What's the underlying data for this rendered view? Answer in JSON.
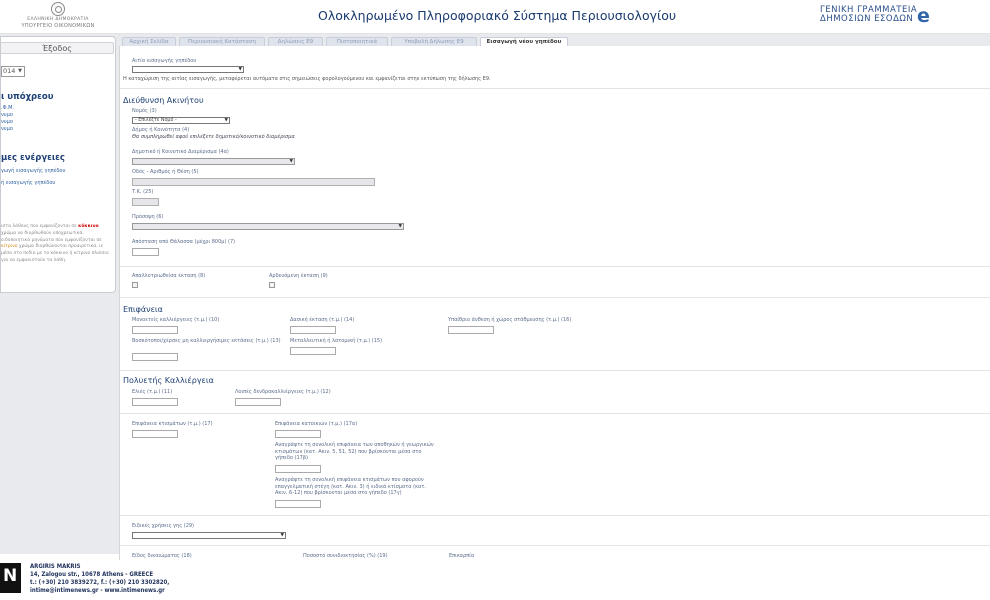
{
  "header": {
    "ministry_line1": "ΕΛΛΗΝΙΚΗ ΔΗΜΟΚΡΑΤΙΑ",
    "ministry_line2": "ΥΠΟΥΡΓΕΙΟ ΟΙΚΟΝΟΜΙΚΩΝ",
    "title": "Ολοκληρωμένο Πληροφοριακό Σύστημα Περιουσιολογίου",
    "gsis_line1": "ΓΕΝΙΚΗ ΓΡΑΜΜΑΤΕΙΑ",
    "gsis_line2": "ΔΗΜΟΣΙΩΝ ΕΣΟΔΩΝ",
    "gsis_mark": "e"
  },
  "sidebar": {
    "exit": "Έξοδος",
    "year": "014",
    "section1": "ι υπόχρεου",
    "links1": [
      ".Φ.Μ.",
      "νυμο",
      "νυμο",
      "νυμο"
    ],
    "section2": "μες ενέργειες",
    "links2": [
      "γωγή εισαγωγής γηπέδου",
      "ή εισαγωγής γηπέδου"
    ],
    "note": [
      "ιστα λάθους που εμφανίζονται σε",
      "κόκκινο",
      "χρώμα να διορθωθούν υποχρεωτικά.",
      "ειδοποιητικά μηνύματα που εμφανίζονται σε",
      "κίτρινο",
      "χρώμα διορθώνονται προαιρετικά.",
      "ιε μέσα στο πεδίο με το κόκκινο ή",
      "κίτρινο πλαίσιο για να εμφανιστούν τα",
      "λάθη."
    ]
  },
  "tabs": [
    "Αρχική Σελίδα",
    "Περιουσιακή Κατάσταση",
    "Δηλώσεις Ε9",
    "Πιστοποιητικά",
    "Υποβολή Δήλωσης Ε9",
    "Εισαγωγή νέου γηπέδου"
  ],
  "form": {
    "cause_label": "Αιτία εισαγωγής γηπέδου",
    "cause_value": "",
    "cause_hint": "Η καταχώριση της αιτίας εισαγωγής, μεταφέρεται αυτόματα στις σημειώσεις φορολογούμενου και εμφανίζεται στην εκτύπωση της δήλωσης Ε9.",
    "address_heading": "Διεύθυνση Ακινήτου",
    "nomos_label": "Νομός (3)",
    "nomos_value": "- Επιλέξτε Νομό -",
    "dimos_label": "Δήμος ή Κοινότητα (4)",
    "dimos_hint": "Θα συμπληρωθεί αφού επιλέξετε δημοτικό/κοινοτικό διαμέρισμα",
    "diam_label": "Δημοτικό ή Κοινοτικό Διαμέρισμα (4α)",
    "odos_label": "Οδός - Αριθμός ή Θέση (5)",
    "tk_label": "Τ.Κ. (25)",
    "prosopsi_label": "Πρόσοψη (6)",
    "apostasi_label": "Απόσταση από Θάλασσα (μέχρι 800μ) (7)",
    "apallotriosi_label": "Απαλλοτριωθείσα έκταση (8)",
    "ardevomeni_label": "Αρδευόμενη έκταση (9)",
    "area_heading": "Επιφάνεια",
    "monoeteis_label": "Μονοετείς καλλιέργειες (τ.μ.) (10)",
    "dasiki_label": "Δασική έκταση (τ.μ.) (14)",
    "ypaithrio_label": "Υπαίθριο άνθεση ή χώρος στάθμευσης (τ.μ.) (16)",
    "voskotopoi_label": "Βοσκότοποι/χέρσες μη καλλιεργήσιμες εκτάσεις (τ.μ.) (13)",
    "metalleutiki_label": "Μεταλλευτική ή λατομική (τ.μ.) (15)",
    "poly_heading": "Πολυετής Καλλιέργεια",
    "elies_label": "Ελιές (τ.μ.) (11)",
    "loipes_label": "Λοιπές δενδροκαλλιέργειες (τ.μ.) (12)",
    "ktismaton_label": "Επιφάνεια κτισμάτων (τ.μ.) (17)",
    "kataskinon_label": "Επιφάνεια κατοικιών (τ.μ.) (17α)",
    "b17_label": "Αναγράψτε τη συνολική επιφάνεια των αποθηκών ή γεωργικών κτισμάτων (κατ. Ακιν. 5, 51, 52) που βρίσκονται μέσα στο γήπεδο (17β)",
    "g17_label": "Αναγράψτε τη συνολική επιφάνεια κτισμάτων που αφορούν επαγγελματική στέγη (κατ. Ακιν. 3) ή ειδικά κτίσματα (κατ. Ακιν. 6-12) που βρίσκονται μέσα στο γήπεδο (17γ)",
    "xrisi_label": "Ειδικές χρήσεις γης (29)",
    "dikaiomatos_label": "Είδος δικαιώματος (18)",
    "pososto_label": "Ποσοστό συνιδιοκτησίας (%) (19)",
    "epikarpia_label": "Επικαρπία"
  },
  "footer": {
    "logo": "N",
    "name": "ARGIRIS MAKRIS",
    "address": "14, Zalogou str., 10678 Athens - GREECE",
    "phone": "t.: (+30) 210 3839272, f.: (+30) 210 3302820,",
    "web": "intime@intimenews.gr - www.intimenews.gr"
  }
}
